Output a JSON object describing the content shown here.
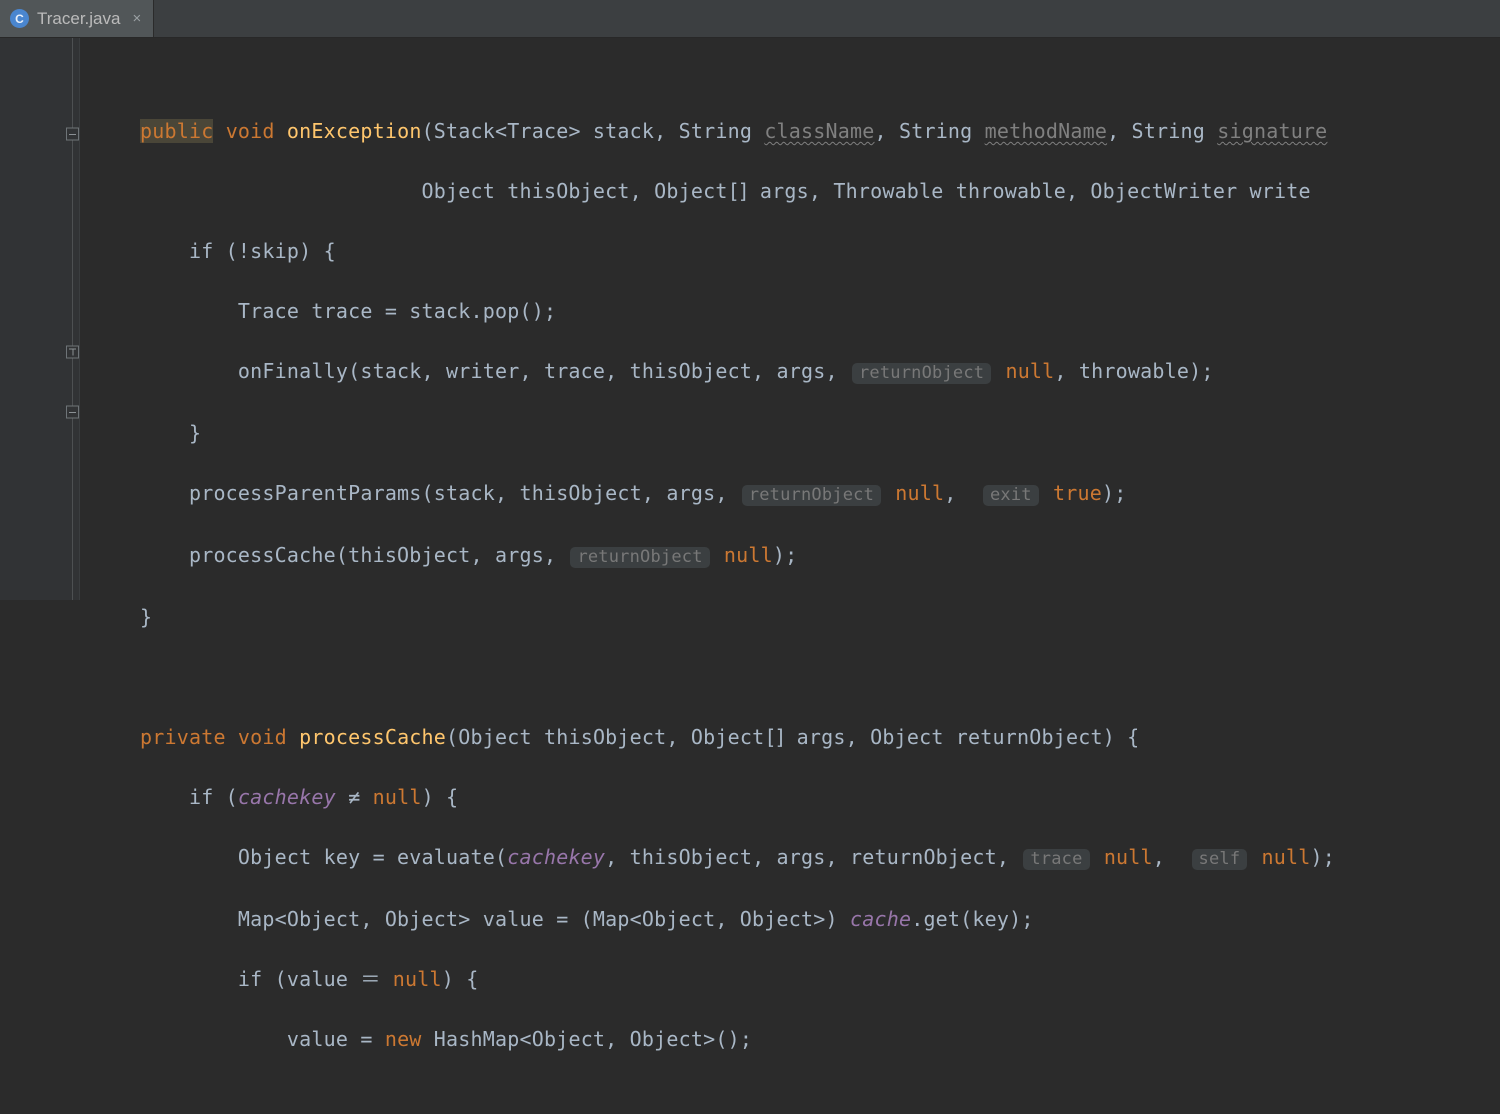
{
  "tab": {
    "icon_letter": "C",
    "filename": "Tracer.java",
    "close_glyph": "×"
  },
  "code": {
    "l1a": "public",
    "l1b": " void ",
    "l1c": "onException",
    "l1d": "(Stack<Trace> stack, String ",
    "l1e": "className",
    "l1f": ", String ",
    "l1g": "methodName",
    "l1h": ", String ",
    "l1i": "signature",
    "l2a": "                       Object thisObject, Object",
    "l2sq": "[]",
    "l2b": " args, Throwable throwable, ObjectWriter write",
    "l3": "    if (!skip) {",
    "l4": "        Trace trace = stack.pop();",
    "l5a": "        onFinally(stack, writer, trace, thisObject, args, ",
    "l5h": "returnObject",
    "l5b": " ",
    "l5n": "null",
    "l5c": ", throwable);",
    "l6": "    }",
    "l7a": "    processParentParams(stack, thisObject, args, ",
    "l7h1": "returnObject",
    "l7b": " ",
    "l7n1": "null",
    "l7c": ",  ",
    "l7h2": "exit",
    "l7d": " ",
    "l7n2": "true",
    "l7e": ");",
    "l8a": "    processCache(thisObject, args, ",
    "l8h": "returnObject",
    "l8b": " ",
    "l8n": "null",
    "l8c": ");",
    "l9": "}",
    "l11a": "private",
    "l11b": " void ",
    "l11c": "processCache",
    "l11d": "(Object thisObject, Object",
    "l11sq": "[]",
    "l11e": " args, Object returnObject) {",
    "l12a": "    if (",
    "l12f": "cachekey",
    "l12b": " ≠ ",
    "l12n": "null",
    "l12c": ") {",
    "l13a": "        Object key = evaluate(",
    "l13f": "cachekey",
    "l13b": ", thisObject, args, returnObject, ",
    "l13h1": "trace",
    "l13c": " ",
    "l13n1": "null",
    "l13d": ",  ",
    "l13h2": "self",
    "l13e": " ",
    "l13n2": "null",
    "l13g": ");",
    "l14a": "        Map<Object, Object> value = (Map<Object, Object>) ",
    "l14f": "cache",
    "l14b": ".get(key);",
    "l15a": "        if (value ＝ ",
    "l15n": "null",
    "l15b": ") {",
    "l16a": "            value = ",
    "l16k": "new",
    "l16b": " HashMap<Object, Object>();"
  }
}
